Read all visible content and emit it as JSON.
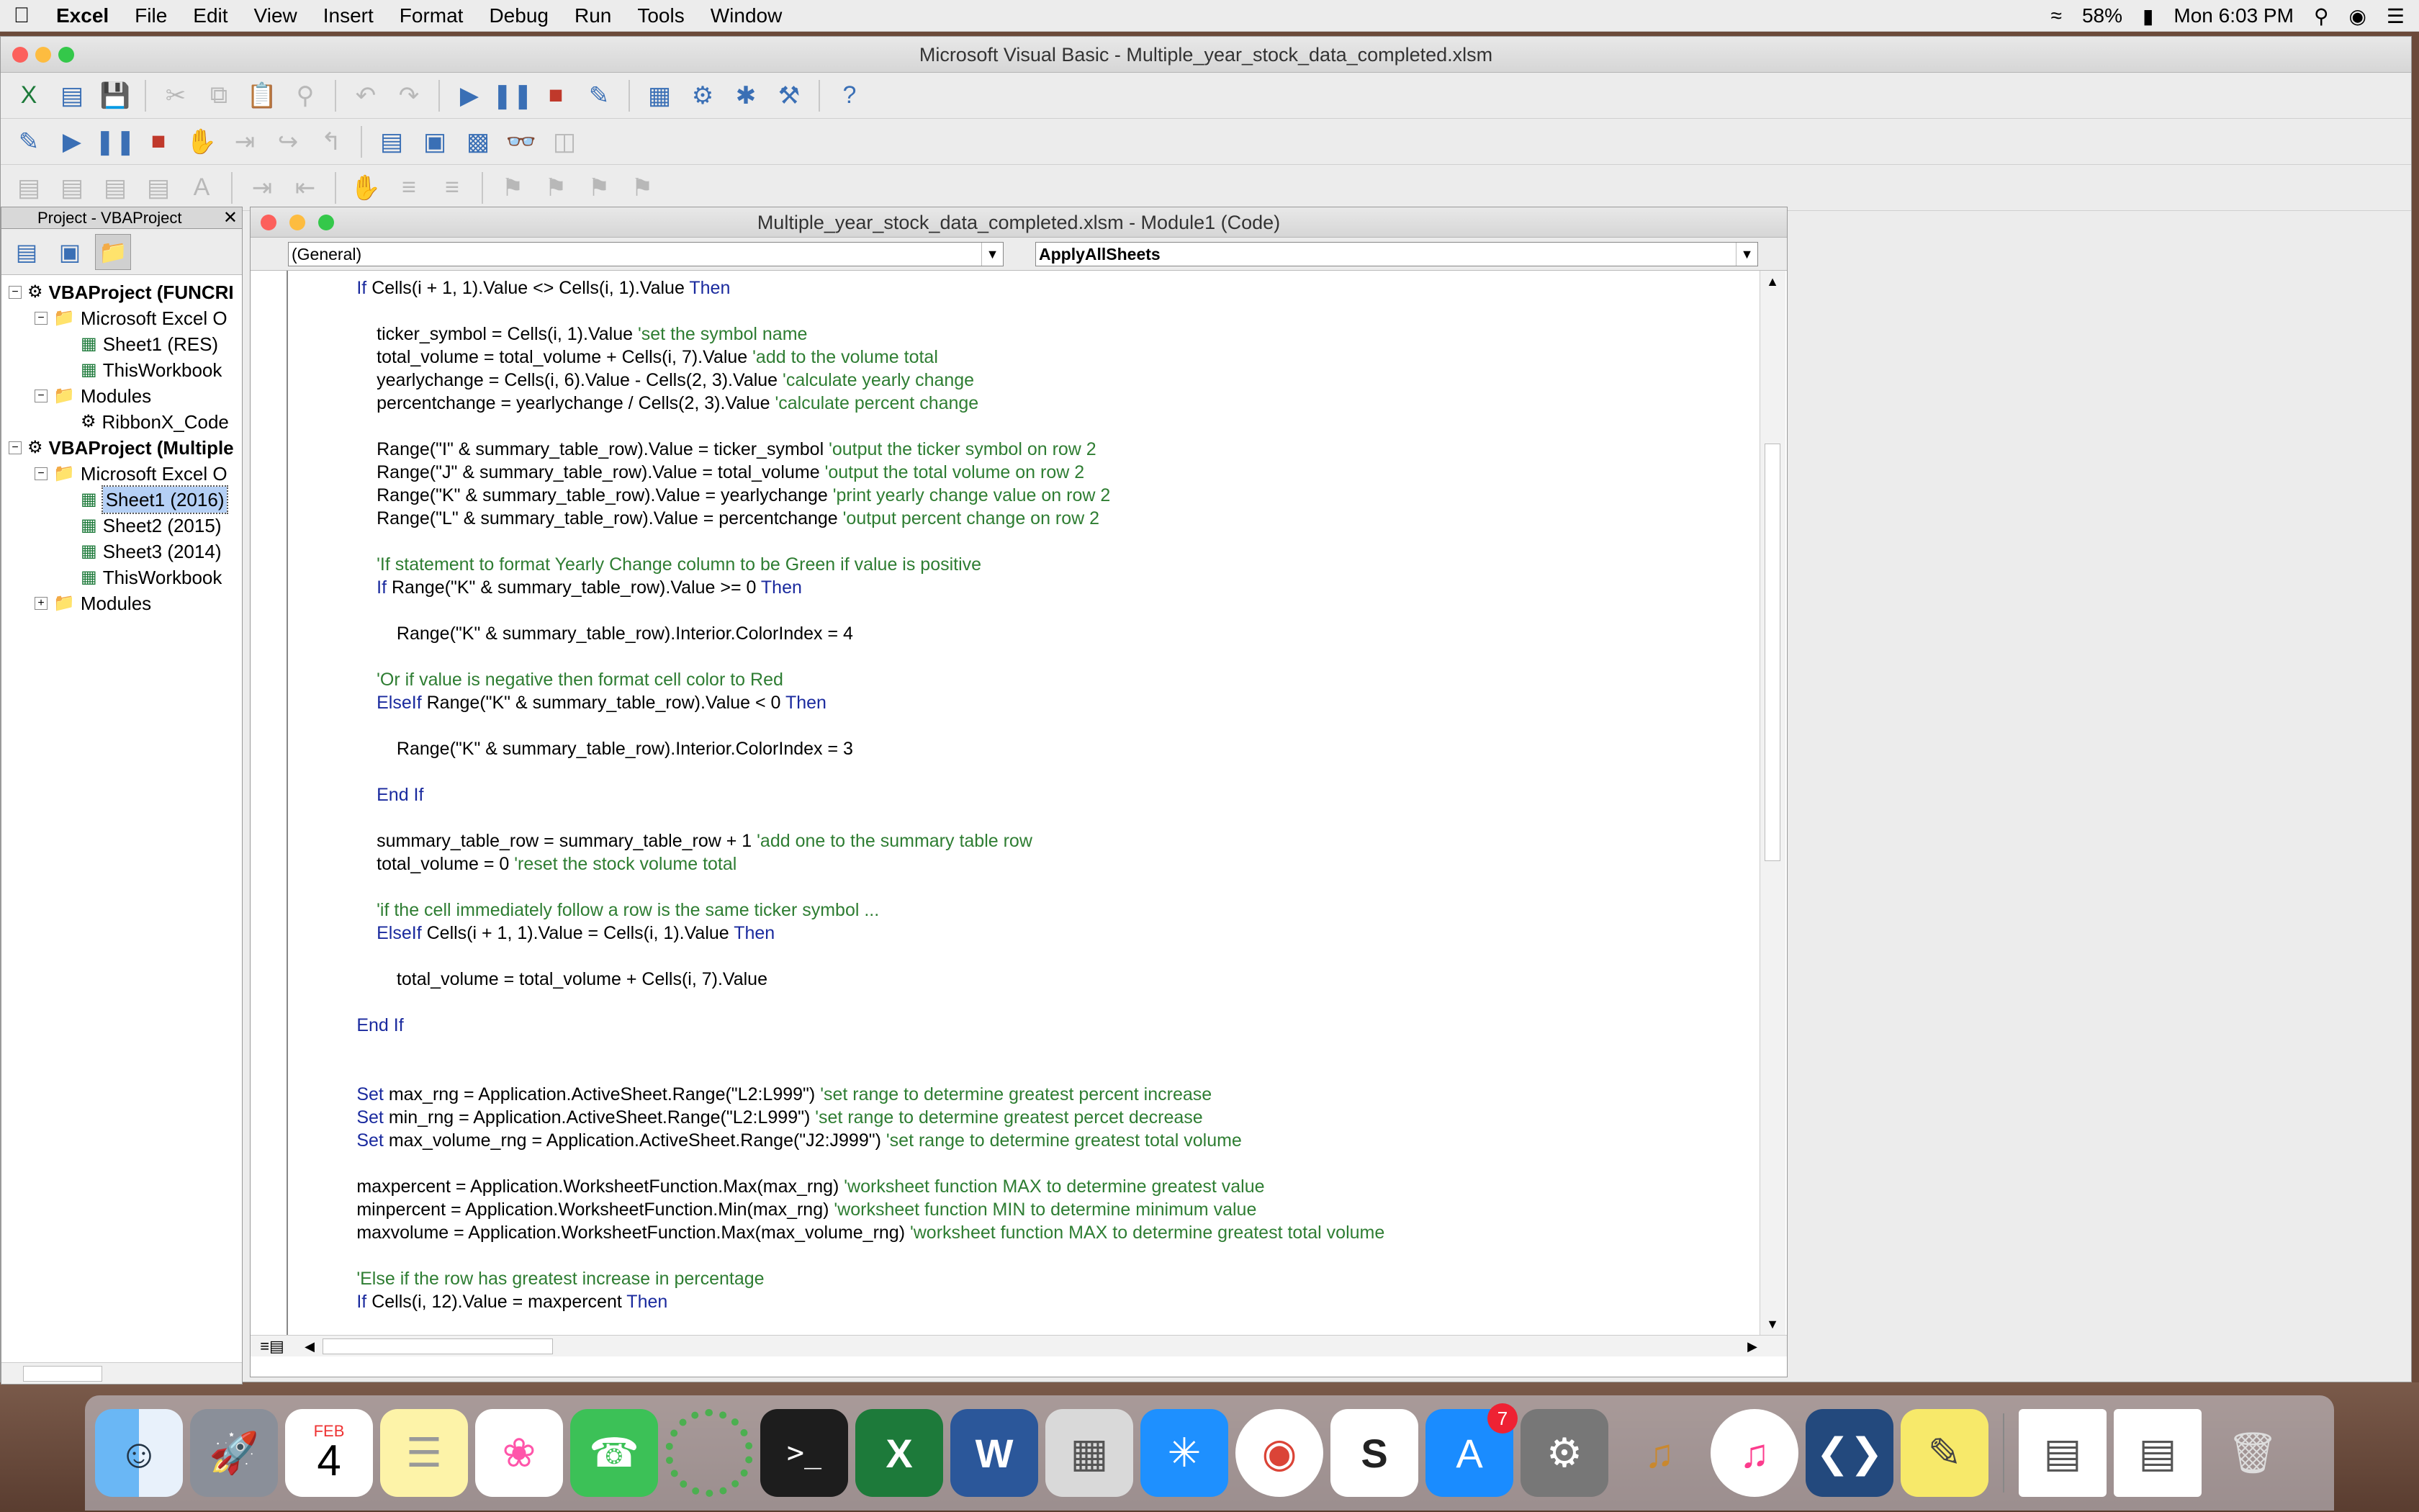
{
  "menubar": {
    "app_name": "Excel",
    "items": [
      "File",
      "Edit",
      "View",
      "Insert",
      "Format",
      "Debug",
      "Run",
      "Tools",
      "Window"
    ],
    "battery": "58%",
    "clock": "Mon 6:03 PM"
  },
  "window": {
    "title": "Microsoft Visual Basic - Multiple_year_stock_data_completed.xlsm"
  },
  "project": {
    "title": "Project - VBAProject",
    "tree": [
      {
        "label": "VBAProject (FUNCRI",
        "level": 0,
        "bold": true
      },
      {
        "label": "Microsoft Excel O",
        "level": 1
      },
      {
        "label": "Sheet1 (RES)",
        "level": 2
      },
      {
        "label": "ThisWorkbook",
        "level": 2
      },
      {
        "label": "Modules",
        "level": 1
      },
      {
        "label": "RibbonX_Code",
        "level": 2
      },
      {
        "label": "VBAProject (Multiple",
        "level": 0,
        "bold": true
      },
      {
        "label": "Microsoft Excel O",
        "level": 1
      },
      {
        "label": "Sheet1 (2016)",
        "level": 2,
        "selected": true
      },
      {
        "label": "Sheet2 (2015)",
        "level": 2
      },
      {
        "label": "Sheet3 (2014)",
        "level": 2
      },
      {
        "label": "ThisWorkbook",
        "level": 2
      },
      {
        "label": "Modules",
        "level": 1
      }
    ]
  },
  "code": {
    "title": "Multiple_year_stock_data_completed.xlsm - Module1 (Code)",
    "object_combo": "(General)",
    "proc_combo": "ApplyAllSheets",
    "lines": [
      [
        {
          "t": "            If ",
          "c": "kw"
        },
        {
          "t": "Cells(i + 1, 1).Value <> Cells(i, 1).Value "
        },
        {
          "t": "Then",
          "c": "kw"
        }
      ],
      [],
      [
        {
          "t": "                ticker_symbol = Cells(i, 1).Value "
        },
        {
          "t": "'set the symbol name",
          "c": "cm"
        }
      ],
      [
        {
          "t": "                total_volume = total_volume + Cells(i, 7).Value "
        },
        {
          "t": "'add to the volume total",
          "c": "cm"
        }
      ],
      [
        {
          "t": "                yearlychange = Cells(i, 6).Value - Cells(2, 3).Value "
        },
        {
          "t": "'calculate yearly change",
          "c": "cm"
        }
      ],
      [
        {
          "t": "                percentchange = yearlychange / Cells(2, 3).Value "
        },
        {
          "t": "'calculate percent change",
          "c": "cm"
        }
      ],
      [],
      [
        {
          "t": "                Range(\"I\" & summary_table_row).Value = ticker_symbol "
        },
        {
          "t": "'output the ticker symbol on row 2",
          "c": "cm"
        }
      ],
      [
        {
          "t": "                Range(\"J\" & summary_table_row).Value = total_volume "
        },
        {
          "t": "'output the total volume on row 2",
          "c": "cm"
        }
      ],
      [
        {
          "t": "                Range(\"K\" & summary_table_row).Value = yearlychange "
        },
        {
          "t": "'print yearly change value on row 2",
          "c": "cm"
        }
      ],
      [
        {
          "t": "                Range(\"L\" & summary_table_row).Value = percentchange "
        },
        {
          "t": "'output percent change on row 2",
          "c": "cm"
        }
      ],
      [],
      [
        {
          "t": "                'If statement to format Yearly Change column to be Green if value is positive",
          "c": "cm"
        }
      ],
      [
        {
          "t": "                If ",
          "c": "kw"
        },
        {
          "t": "Range(\"K\" & summary_table_row).Value >= 0 "
        },
        {
          "t": "Then",
          "c": "kw"
        }
      ],
      [],
      [
        {
          "t": "                    Range(\"K\" & summary_table_row).Interior.ColorIndex = 4"
        }
      ],
      [],
      [
        {
          "t": "                'Or if value is negative then format cell color to Red",
          "c": "cm"
        }
      ],
      [
        {
          "t": "                ElseIf ",
          "c": "kw"
        },
        {
          "t": "Range(\"K\" & summary_table_row).Value < 0 "
        },
        {
          "t": "Then",
          "c": "kw"
        }
      ],
      [],
      [
        {
          "t": "                    Range(\"K\" & summary_table_row).Interior.ColorIndex = 3"
        }
      ],
      [],
      [
        {
          "t": "                End If",
          "c": "kw"
        }
      ],
      [],
      [
        {
          "t": "                summary_table_row = summary_table_row + 1 "
        },
        {
          "t": "'add one to the summary table row",
          "c": "cm"
        }
      ],
      [
        {
          "t": "                total_volume = 0 "
        },
        {
          "t": "'reset the stock volume total",
          "c": "cm"
        }
      ],
      [],
      [
        {
          "t": "                'if the cell immediately follow a row is the same ticker symbol ...",
          "c": "cm"
        }
      ],
      [
        {
          "t": "                ElseIf ",
          "c": "kw"
        },
        {
          "t": "Cells(i + 1, 1).Value = Cells(i, 1).Value "
        },
        {
          "t": "Then",
          "c": "kw"
        }
      ],
      [],
      [
        {
          "t": "                    total_volume = total_volume + Cells(i, 7).Value"
        }
      ],
      [],
      [
        {
          "t": "            End If",
          "c": "kw"
        }
      ],
      [],
      [],
      [
        {
          "t": "            Set ",
          "c": "kw"
        },
        {
          "t": "max_rng = Application.ActiveSheet.Range(\"L2:L999\") "
        },
        {
          "t": "'set range to determine greatest percent increase",
          "c": "cm"
        }
      ],
      [
        {
          "t": "            Set ",
          "c": "kw"
        },
        {
          "t": "min_rng = Application.ActiveSheet.Range(\"L2:L999\") "
        },
        {
          "t": "'set range to determine greatest percet decrease",
          "c": "cm"
        }
      ],
      [
        {
          "t": "            Set ",
          "c": "kw"
        },
        {
          "t": "max_volume_rng = Application.ActiveSheet.Range(\"J2:J999\") "
        },
        {
          "t": "'set range to determine greatest total volume",
          "c": "cm"
        }
      ],
      [],
      [
        {
          "t": "            maxpercent = Application.WorksheetFunction.Max(max_rng) "
        },
        {
          "t": "'worksheet function MAX to determine greatest value",
          "c": "cm"
        }
      ],
      [
        {
          "t": "            minpercent = Application.WorksheetFunction.Min(max_rng) "
        },
        {
          "t": "'worksheet function MIN to determine minimum value",
          "c": "cm"
        }
      ],
      [
        {
          "t": "            maxvolume = Application.WorksheetFunction.Max(max_volume_rng) "
        },
        {
          "t": "'worksheet function MAX to determine greatest total volume",
          "c": "cm"
        }
      ],
      [],
      [
        {
          "t": "            'Else if the row has greatest increase in percentage",
          "c": "cm"
        }
      ],
      [
        {
          "t": "            If ",
          "c": "kw"
        },
        {
          "t": "Cells(i, 12).Value = maxpercent "
        },
        {
          "t": "Then",
          "c": "kw"
        }
      ]
    ]
  },
  "dock": {
    "calendar_month": "FEB",
    "calendar_day": "4",
    "appstore_badge": "7"
  }
}
